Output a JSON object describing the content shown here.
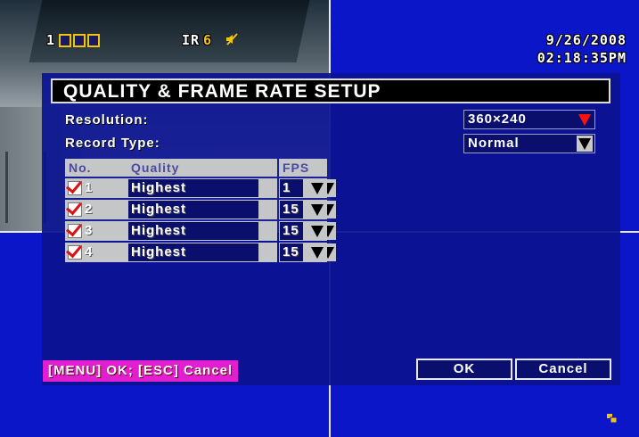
{
  "camera": {
    "channel": "1",
    "ir_label": "IR",
    "ir_value": "6",
    "date": "9/26/2008",
    "time": "02:18:35PM"
  },
  "dialog": {
    "title": "QUALITY & FRAME RATE SETUP",
    "resolution": {
      "label": "Resolution:",
      "value": "360×240"
    },
    "record_type": {
      "label": "Record Type:",
      "value": "Normal"
    },
    "table": {
      "headers": {
        "no": "No.",
        "quality": "Quality",
        "fps": "FPS"
      },
      "rows": [
        {
          "no": "1",
          "quality": "Highest",
          "fps": "1",
          "checked": true
        },
        {
          "no": "2",
          "quality": "Highest",
          "fps": "15",
          "checked": true
        },
        {
          "no": "3",
          "quality": "Highest",
          "fps": "15",
          "checked": true
        },
        {
          "no": "4",
          "quality": "Highest",
          "fps": "15",
          "checked": true
        }
      ]
    },
    "hint": "[MENU] OK; [ESC] Cancel",
    "ok_label": "OK",
    "cancel_label": "Cancel"
  },
  "colors": {
    "background": "#0b16c8",
    "hint_bg": "#e21fd0",
    "checkmark": "#e01010",
    "accent_yellow": "#f1c40f"
  }
}
